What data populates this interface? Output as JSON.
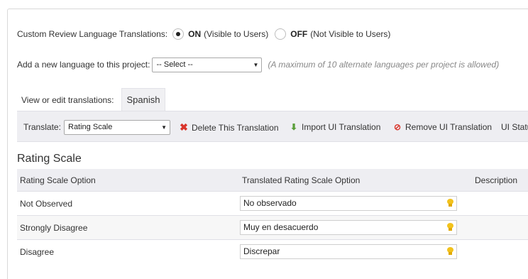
{
  "review_translations": {
    "label": "Custom Review Language Translations:",
    "on_label": "ON",
    "on_desc": "(Visible to Users)",
    "off_label": "OFF",
    "off_desc": "(Not Visible to Users)",
    "selected": "ON"
  },
  "add_language": {
    "label": "Add a new language to this project:",
    "select_value": "-- Select --",
    "hint": "(A maximum of 10 alternate languages per project is allowed)"
  },
  "view_edit": {
    "label": "View or edit translations:",
    "tabs": [
      {
        "label": "Spanish",
        "active": true
      }
    ]
  },
  "toolbar": {
    "translate_label": "Translate:",
    "translate_value": "Rating Scale",
    "delete_label": "Delete This Translation",
    "import_label": "Import UI Translation",
    "remove_label": "Remove UI Translation",
    "status_label": "UI Statu"
  },
  "section": {
    "title": "Rating Scale"
  },
  "table": {
    "headers": [
      "Rating Scale Option",
      "Translated Rating Scale Option",
      "Description"
    ],
    "rows": [
      {
        "option": "Not Observed",
        "translated": "No observado",
        "description": ""
      },
      {
        "option": "Strongly Disagree",
        "translated": "Muy en desacuerdo",
        "description": ""
      },
      {
        "option": "Disagree",
        "translated": "Discrepar",
        "description": ""
      }
    ]
  },
  "colors": {
    "accent_bg": "#eeeef2",
    "delete_icon": "#d9342b",
    "import_icon": "#5a9e3a",
    "remove_icon": "#d9342b",
    "bulb": "#f2c21c"
  }
}
